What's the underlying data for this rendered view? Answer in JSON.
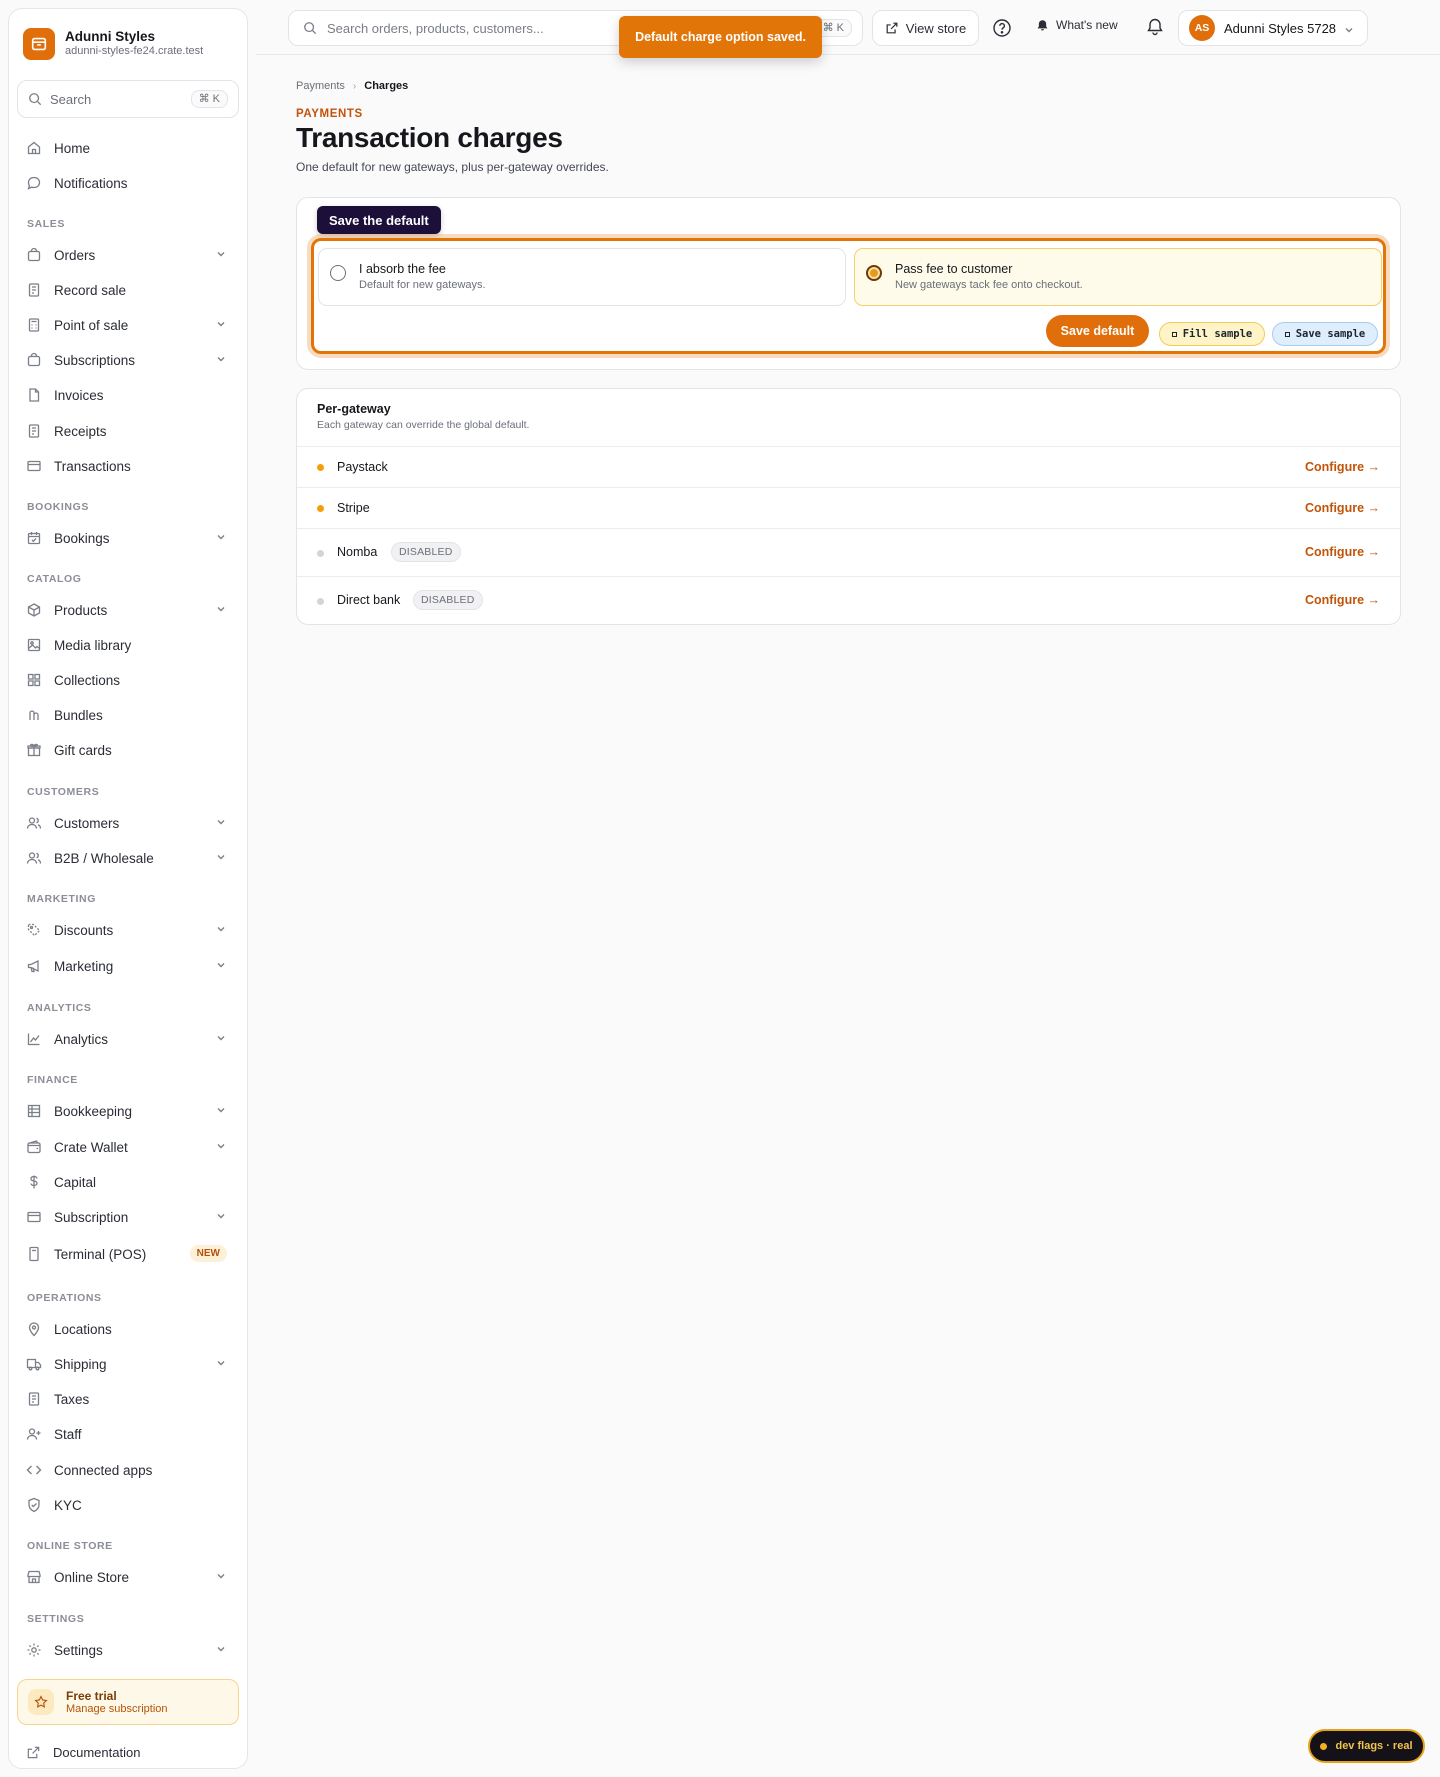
{
  "brand": {
    "name": "Adunni Styles",
    "domain": "adunni-styles-fe24.crate.test"
  },
  "sidebar_search": {
    "label": "Search",
    "shortcut": "⌘ K"
  },
  "nav": {
    "home": "Home",
    "notifications": "Notifications",
    "sales_header": "SALES",
    "orders": "Orders",
    "record_sale": "Record sale",
    "point_of_sale": "Point of sale",
    "subscriptions": "Subscriptions",
    "invoices": "Invoices",
    "receipts": "Receipts",
    "transactions": "Transactions",
    "bookings_header": "BOOKINGS",
    "bookings": "Bookings",
    "catalog_header": "CATALOG",
    "products": "Products",
    "media_library": "Media library",
    "collections": "Collections",
    "bundles": "Bundles",
    "gift_cards": "Gift cards",
    "customers_header": "CUSTOMERS",
    "customers": "Customers",
    "b2b": "B2B / Wholesale",
    "marketing_header": "MARKETING",
    "discounts": "Discounts",
    "marketing": "Marketing",
    "analytics_header": "ANALYTICS",
    "analytics": "Analytics",
    "finance_header": "FINANCE",
    "bookkeeping": "Bookkeeping",
    "crate_wallet": "Crate Wallet",
    "capital": "Capital",
    "subscription": "Subscription",
    "terminal": "Terminal (POS)",
    "terminal_badge": "NEW",
    "operations_header": "OPERATIONS",
    "locations": "Locations",
    "shipping": "Shipping",
    "taxes": "Taxes",
    "staff": "Staff",
    "connected_apps": "Connected apps",
    "kyc": "KYC",
    "online_store_header": "ONLINE STORE",
    "online_store": "Online Store",
    "settings_header": "SETTINGS",
    "settings": "Settings"
  },
  "trial": {
    "title": "Free trial",
    "subtitle": "Manage subscription"
  },
  "documentation": "Documentation",
  "topbar": {
    "search_placeholder": "Search orders, products, customers...",
    "search_shortcut": "⌘ K",
    "view_store": "View store",
    "whats_new": "What's new",
    "account_initials": "AS",
    "account_name": "Adunni Styles 5728"
  },
  "toast": "Default charge option saved.",
  "breadcrumb": {
    "parent": "Payments",
    "current": "Charges"
  },
  "page": {
    "eyebrow": "PAYMENTS",
    "title": "Transaction charges",
    "subtitle": "One default for new gateways, plus per-gateway overrides."
  },
  "default_card": {
    "tooltip": "Save the default",
    "option_absorb": {
      "title": "I absorb the fee",
      "subtitle": "Default for new gateways.",
      "selected": false
    },
    "option_pass": {
      "title": "Pass fee to customer",
      "subtitle": "New gateways tack fee onto checkout.",
      "selected": true
    },
    "save_label": "Save default",
    "fill_sample": "Fill sample",
    "save_sample": "Save sample"
  },
  "per_gateway": {
    "title": "Per-gateway",
    "subtitle": "Each gateway can override the global default.",
    "configure_label": "Configure →",
    "gateways": [
      {
        "name": "Paystack",
        "status": "active",
        "badge": ""
      },
      {
        "name": "Stripe",
        "status": "active",
        "badge": ""
      },
      {
        "name": "Nomba",
        "status": "disabled",
        "badge": "DISABLED"
      },
      {
        "name": "Direct bank",
        "status": "disabled",
        "badge": "DISABLED"
      }
    ]
  },
  "dev_flags": "dev flags · real",
  "colors": {
    "accent": "#e06f0b",
    "active_dot": "#f59e0b",
    "disabled_dot": "#d4d4d8",
    "link": "#c2540a"
  }
}
